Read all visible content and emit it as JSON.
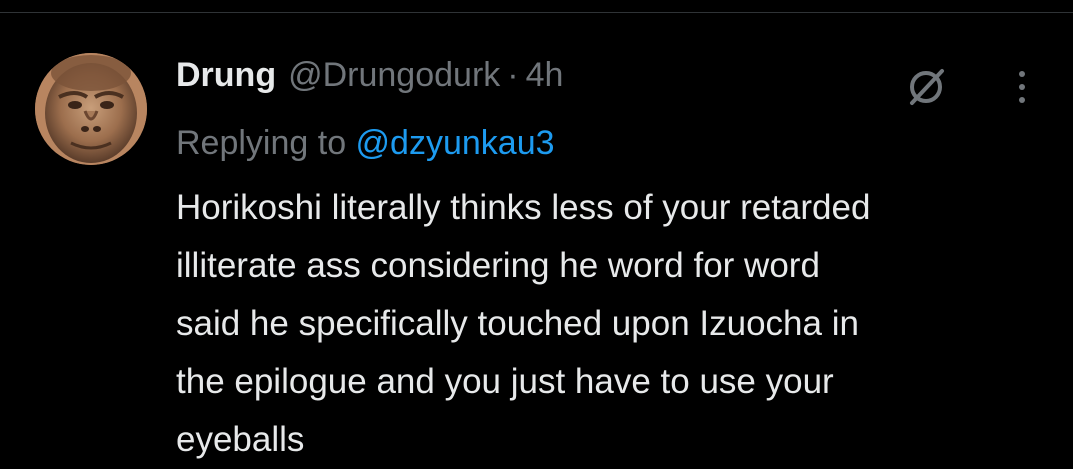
{
  "post": {
    "display_name": "Drung",
    "handle": "@Drungodurk",
    "separator": "·",
    "time": "4h",
    "reply_prefix": "Replying to",
    "reply_mention": "@dzyunkau3",
    "text": "Horikoshi literally thinks less of your retarded\nilliterate ass considering he word for word\nsaid he specifically touched upon Izuocha in\nthe epilogue and you just have to use your\neyeballs"
  },
  "icons": {
    "grok": "grok-icon",
    "more": "more-icon",
    "avatar": "avatar-image"
  },
  "colors": {
    "background": "#000000",
    "primary_text": "#e7e9ea",
    "secondary_text": "#71767b",
    "link": "#1d9bf0",
    "divider": "#2f3336"
  }
}
